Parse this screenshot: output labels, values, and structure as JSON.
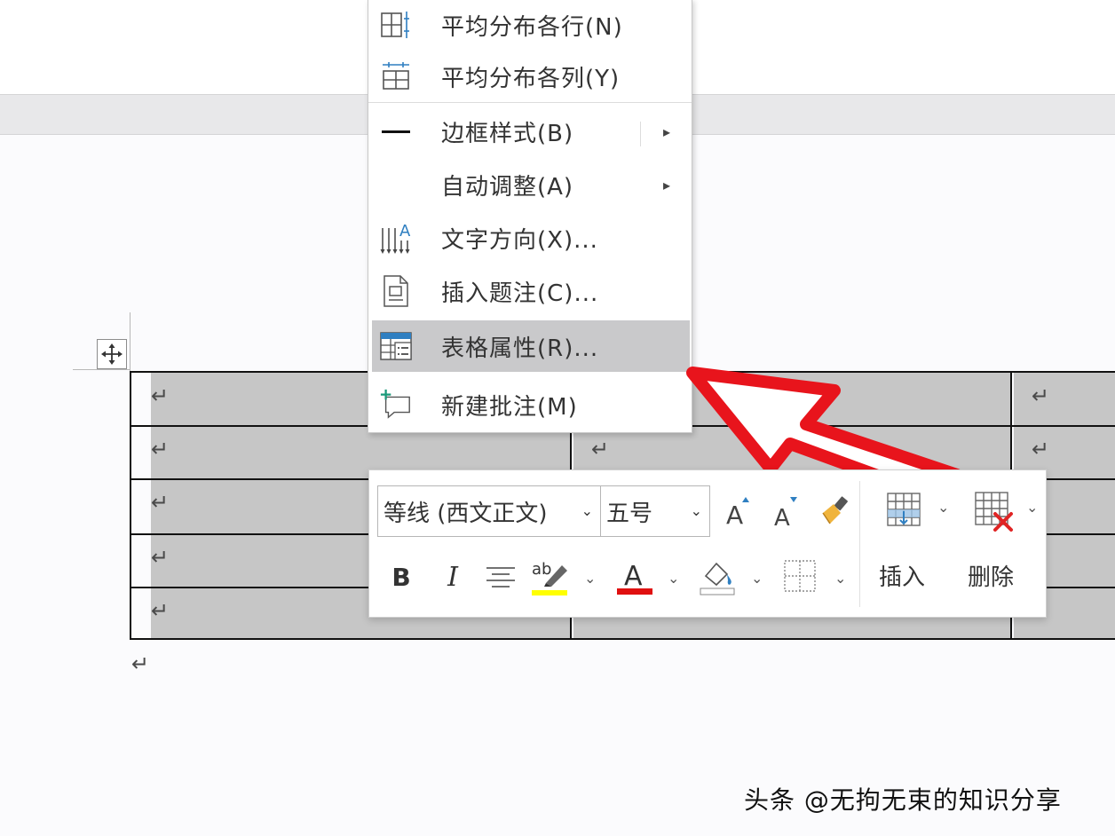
{
  "context_menu": {
    "items": [
      {
        "label": "平均分布各行(N)",
        "icon": "distribute-rows-icon"
      },
      {
        "label": "平均分布各列(Y)",
        "icon": "distribute-columns-icon"
      },
      {
        "label": "边框样式(B)",
        "icon": "border-style-icon",
        "submenu": true
      },
      {
        "label": "自动调整(A)",
        "icon": "",
        "submenu": true
      },
      {
        "label": "文字方向(X)...",
        "icon": "text-direction-icon"
      },
      {
        "label": "插入题注(C)...",
        "icon": "insert-caption-icon"
      },
      {
        "label": "表格属性(R)...",
        "icon": "table-properties-icon",
        "highlighted": true
      },
      {
        "label": "新建批注(M)",
        "icon": "new-comment-icon"
      }
    ],
    "submenu_glyph": "▸"
  },
  "mini_toolbar": {
    "font_name": "等线 (西文正文)",
    "font_size": "五号",
    "dropdown_glyph": "⌄",
    "bold": "B",
    "italic": "I",
    "highlight_color": "#ffff00",
    "font_color": "#e01010",
    "insert_label": "插入",
    "delete_label": "删除"
  },
  "document": {
    "paragraph_mark": "↵"
  },
  "watermark": "头条 @无拘无束的知识分享",
  "colors": {
    "arrow": "#e8141c",
    "selection": "#c6c6c6",
    "highlight_item": "#c9c9cb"
  }
}
